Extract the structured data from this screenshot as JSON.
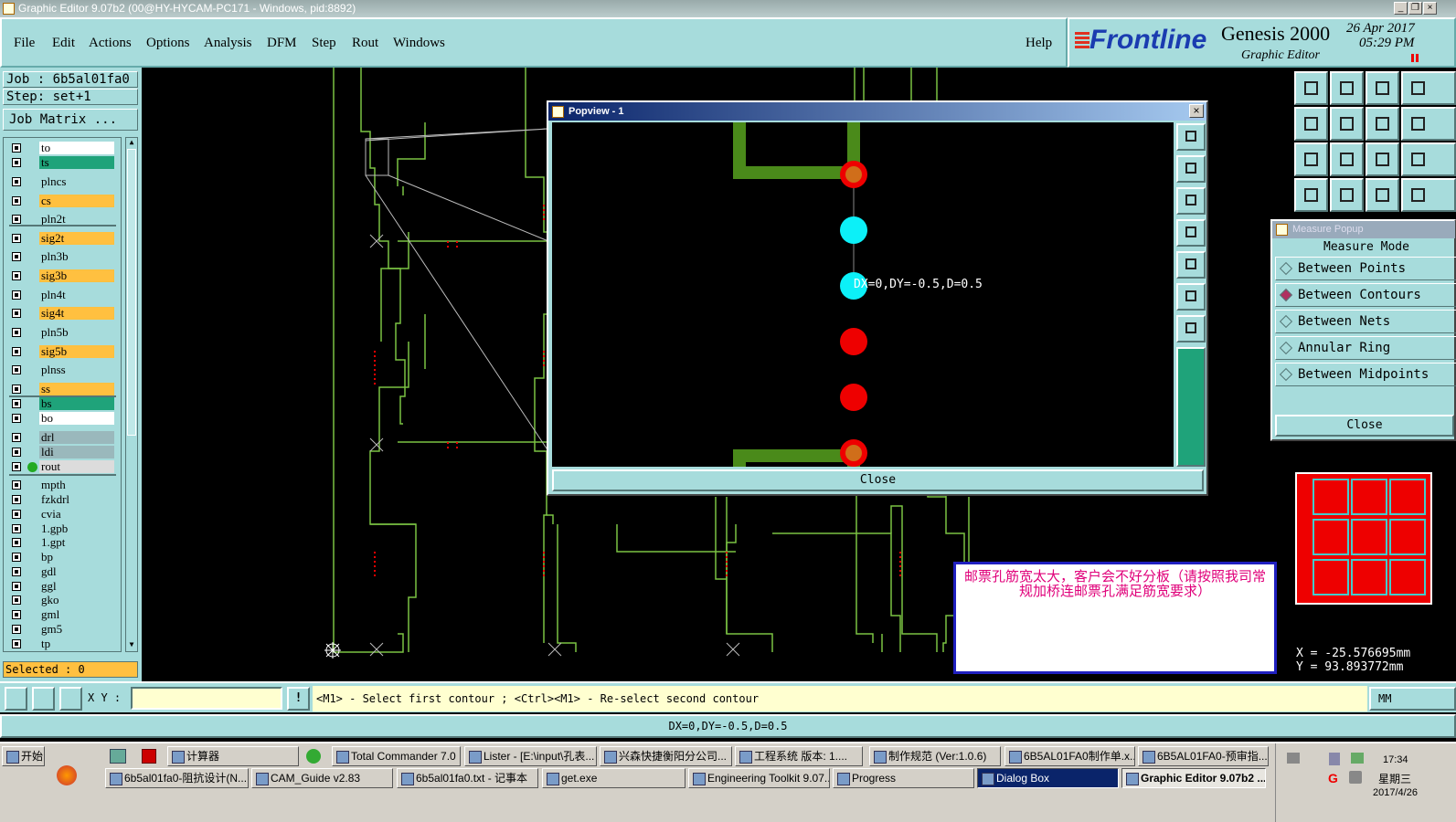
{
  "window": {
    "title": "Graphic Editor 9.07b2 (00@HY-HYCAM-PC171 - Windows, pid:8892)"
  },
  "menu": [
    "File",
    "Edit",
    "Actions",
    "Options",
    "Analysis",
    "DFM",
    "Step",
    "Rout",
    "Windows"
  ],
  "help_label": "Help",
  "brand": {
    "logo": "Frontline",
    "product": "Genesis 2000",
    "subtitle": "Graphic Editor",
    "date": "26 Apr 2017",
    "time": "05:29 PM"
  },
  "job": {
    "job": "Job : 6b5al01fa0",
    "step": "Step: set+1",
    "matrix_button": "Job Matrix ..."
  },
  "layers": [
    {
      "name": "to",
      "color": "#ffffff"
    },
    {
      "name": "ts",
      "color": "#1fa37a"
    },
    {
      "name": "plncs",
      "color": "#a7dcdc"
    },
    {
      "name": "cs",
      "color": "#ffc040"
    },
    {
      "name": "pln2t",
      "color": "#a7dcdc"
    },
    {
      "name": "sig2t",
      "color": "#ffc040"
    },
    {
      "name": "pln3b",
      "color": "#a7dcdc"
    },
    {
      "name": "sig3b",
      "color": "#ffc040"
    },
    {
      "name": "pln4t",
      "color": "#a7dcdc"
    },
    {
      "name": "sig4t",
      "color": "#ffc040"
    },
    {
      "name": "pln5b",
      "color": "#a7dcdc"
    },
    {
      "name": "sig5b",
      "color": "#ffc040"
    },
    {
      "name": "plnss",
      "color": "#a7dcdc"
    },
    {
      "name": "ss",
      "color": "#ffc040"
    },
    {
      "name": "bs",
      "color": "#1fa37a"
    },
    {
      "name": "bo",
      "color": "#ffffff"
    },
    {
      "name": "drl",
      "color": "#9ab8bc"
    },
    {
      "name": "ldi",
      "color": "#9ab8bc"
    },
    {
      "name": "rout",
      "color": "#dcdcdc"
    },
    {
      "name": "mpth",
      "color": "#a7dcdc"
    },
    {
      "name": "fzkdrl",
      "color": "#a7dcdc"
    },
    {
      "name": "cvia",
      "color": "#a7dcdc"
    },
    {
      "name": "1.gpb",
      "color": "#a7dcdc"
    },
    {
      "name": "1.gpt",
      "color": "#a7dcdc"
    },
    {
      "name": "bp",
      "color": "#a7dcdc"
    },
    {
      "name": "gdl",
      "color": "#a7dcdc"
    },
    {
      "name": "ggl",
      "color": "#a7dcdc"
    },
    {
      "name": "gko",
      "color": "#a7dcdc"
    },
    {
      "name": "gml",
      "color": "#a7dcdc"
    },
    {
      "name": "gm5",
      "color": "#a7dcdc"
    },
    {
      "name": "tp",
      "color": "#a7dcdc"
    }
  ],
  "selected": "Selected : 0",
  "popview": {
    "title": "Popview - 1",
    "measure_text": "DX=0,DY=-0.5,D=0.5",
    "close": "Close"
  },
  "measure": {
    "title": "Measure Popup",
    "mode_label": "Measure Mode",
    "options": [
      "Between Points",
      "Between Contours",
      "Between Nets",
      "Annular Ring",
      "Between Midpoints"
    ],
    "selected_index": 1,
    "close": "Close"
  },
  "note": "邮票孔筋宽太大，客户会不好分板（请按照我司常规加桥连邮票孔满足筋宽要求）",
  "coords": {
    "x": "X = -25.576695mm",
    "y": "Y = 93.893772mm"
  },
  "command": {
    "xy_label": "X Y :",
    "prompt": "<M1> - Select first contour ; <Ctrl><M1> - Re-select second contour",
    "units": "MM"
  },
  "status": "DX=0,DY=-0.5,D=0.5",
  "taskbar": {
    "start": "开始",
    "row1": [
      "计算器",
      "Total Commander 7.0 ...",
      "Lister - [E:\\input\\孔表...",
      "兴森快捷衡阳分公司...",
      "工程系统  版本: 1....",
      "制作规范 (Ver:1.0.6)",
      "6B5AL01FA0制作单.x...",
      "6B5AL01FA0-预审指..."
    ],
    "row2": [
      "6b5al01fa0-阻抗设计(N...",
      "CAM_Guide v2.83",
      "6b5al01fa0.txt - 记事本",
      "get.exe",
      "Engineering Toolkit 9.07...",
      "Progress",
      "Dialog Box",
      "Graphic Editor 9.07b2 ..."
    ],
    "clock": "17:34",
    "weekday": "星期三",
    "date": "2017/4/26"
  }
}
